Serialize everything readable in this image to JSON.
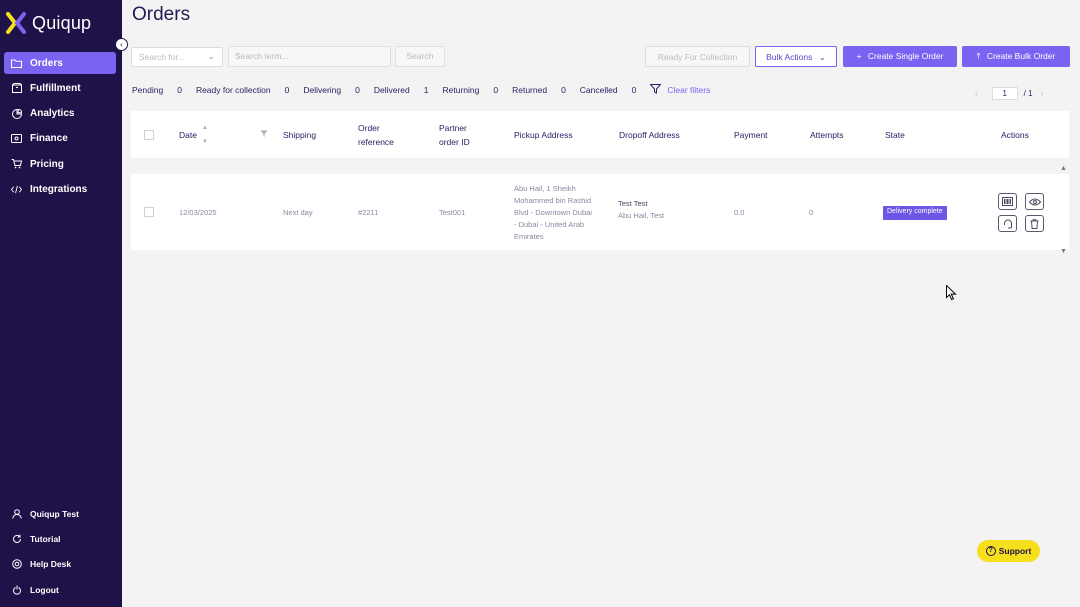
{
  "brand": {
    "name": "Quiqup",
    "colors": {
      "sidebar": "#1f1248",
      "accent": "#7a63f0",
      "support": "#f6df1c"
    }
  },
  "sidebar": {
    "collapse_icon": "chevron-left-icon",
    "items": [
      {
        "label": "Orders",
        "icon": "folder-icon",
        "active": true
      },
      {
        "label": "Fulfillment",
        "icon": "box-icon"
      },
      {
        "label": "Analytics",
        "icon": "chart-icon"
      },
      {
        "label": "Finance",
        "icon": "money-icon"
      },
      {
        "label": "Pricing",
        "icon": "cart-icon"
      },
      {
        "label": "Integrations",
        "icon": "code-icon"
      }
    ],
    "bottom_items": [
      {
        "label": "Quiqup Test",
        "icon": "user-icon"
      },
      {
        "label": "Tutorial",
        "icon": "refresh-icon"
      },
      {
        "label": "Help Desk",
        "icon": "help-icon"
      },
      {
        "label": "Logout",
        "icon": "logout-icon"
      }
    ]
  },
  "page": {
    "title": "Orders"
  },
  "toolbar": {
    "search_for_placeholder": "Search for...",
    "search_term_placeholder": "Search term...",
    "search_label": "Search",
    "ready_for_collection_label": "Ready For Collection",
    "bulk_actions_label": "Bulk Actions",
    "create_single_label": "Create Single Order",
    "create_bulk_label": "Create Bulk Order"
  },
  "status_filters": {
    "items": [
      {
        "label": "Pending",
        "count": "0"
      },
      {
        "label": "Ready for collection",
        "count": "0"
      },
      {
        "label": "Delivering",
        "count": "0"
      },
      {
        "label": "Delivered",
        "count": "1"
      },
      {
        "label": "Returning",
        "count": "0"
      },
      {
        "label": "Returned",
        "count": "0"
      },
      {
        "label": "Cancelled",
        "count": "0"
      }
    ],
    "clear_label": "Clear filters"
  },
  "pagination": {
    "current": "1",
    "total": "/ 1"
  },
  "table": {
    "columns": {
      "date": "Date",
      "shipping": "Shipping",
      "order_reference_1": "Order",
      "order_reference_2": "reference",
      "partner_order_1": "Partner",
      "partner_order_2": "order ID",
      "pickup": "Pickup Address",
      "dropoff": "Dropoff Address",
      "payment": "Payment",
      "attempts": "Attempts",
      "state": "State",
      "actions": "Actions"
    },
    "rows": [
      {
        "date": "12/03/2025",
        "shipping": "Next day",
        "order_reference": "#2211",
        "partner_order_id": "Test001",
        "pickup_lines": [
          "Abu Hail, 1 Sheikh",
          "Mohammed bin Rashid",
          "Blvd - Downtown Dubai",
          "- Dubai - United Arab",
          "Emirates"
        ],
        "dropoff_name": "Test Test",
        "dropoff_address": "Abu Hail, Test",
        "payment": "0.0",
        "attempts": "0",
        "state": "Delivery complete"
      }
    ]
  },
  "support": {
    "label": "Support",
    "icon": "help-icon"
  }
}
